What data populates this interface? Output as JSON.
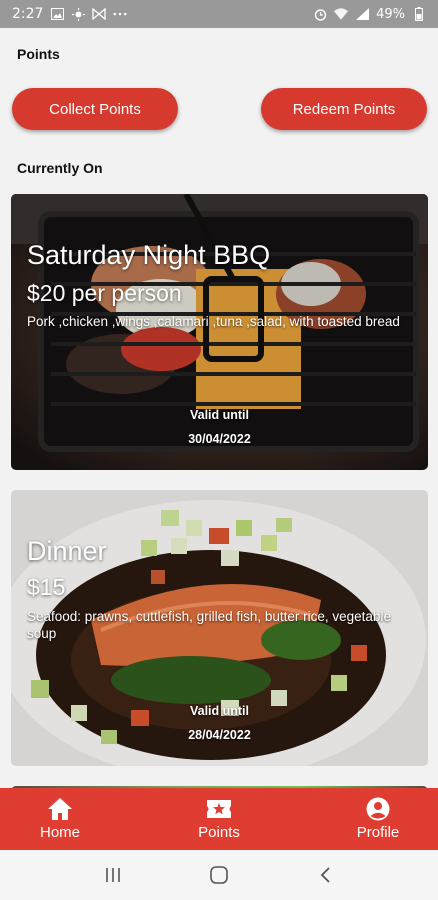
{
  "status_bar": {
    "time": "2:27",
    "battery": "49%",
    "icons_left": [
      "gallery-icon",
      "brightness-icon",
      "butterfly-icon",
      "more-dots-icon"
    ],
    "icons_right": [
      "alarm-icon",
      "wifi-icon",
      "signal-icon",
      "battery-icon"
    ]
  },
  "header": {
    "title": "Points"
  },
  "actions": {
    "collect_label": "Collect Points",
    "redeem_label": "Redeem Points"
  },
  "section": {
    "title": "Currently On"
  },
  "offers": [
    {
      "title": "Saturday Night BBQ",
      "price": "$20 per person",
      "description": "Pork ,chicken ,wings ,calamari ,tuna ,salad, with toasted bread",
      "valid_label": "Valid until",
      "valid_date": "30/04/2022"
    },
    {
      "title": "Dinner",
      "price": "$15",
      "description": "Seafood: prawns, cuttlefish, grilled fish, butter rice, vegetable soup",
      "valid_label": "Valid until",
      "valid_date": "28/04/2022"
    }
  ],
  "bottom_nav": [
    {
      "label": "Home",
      "icon": "home-icon"
    },
    {
      "label": "Points",
      "icon": "ticket-star-icon"
    },
    {
      "label": "Profile",
      "icon": "account-circle-icon"
    }
  ],
  "colors": {
    "accent": "#df3d31",
    "button": "#d63a2f",
    "status_bar": "#999999"
  }
}
